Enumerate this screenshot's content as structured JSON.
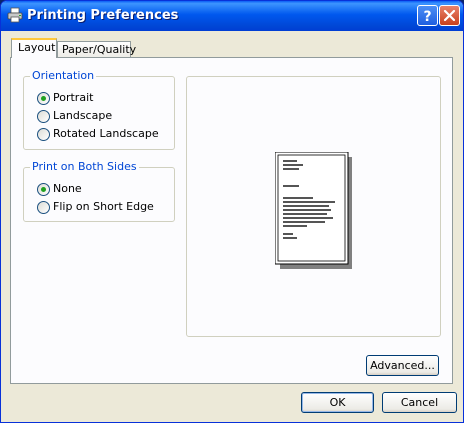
{
  "window": {
    "title": "Printing Preferences"
  },
  "title_buttons": {
    "help": "?",
    "close": "close"
  },
  "tabs": [
    {
      "label": "Layout",
      "active": true
    },
    {
      "label": "Paper/Quality",
      "active": false
    }
  ],
  "orientation": {
    "legend": "Orientation",
    "options": [
      {
        "label": "Portrait",
        "selected": true
      },
      {
        "label": "Landscape",
        "selected": false
      },
      {
        "label": "Rotated Landscape",
        "selected": false
      }
    ]
  },
  "duplex": {
    "legend": "Print on Both Sides",
    "options": [
      {
        "label": "None",
        "selected": true
      },
      {
        "label": "Flip on Short Edge",
        "selected": false
      }
    ]
  },
  "buttons": {
    "advanced": "Advanced...",
    "ok": "OK",
    "cancel": "Cancel"
  },
  "colors": {
    "titlebar": "#0058ee",
    "face": "#ece9d8",
    "radio_dot": "#21a121",
    "legend": "#0046d5",
    "tab_accent": "#ffc83c"
  },
  "icons": {
    "title": "printer-icon",
    "preview": "page-preview-icon"
  }
}
